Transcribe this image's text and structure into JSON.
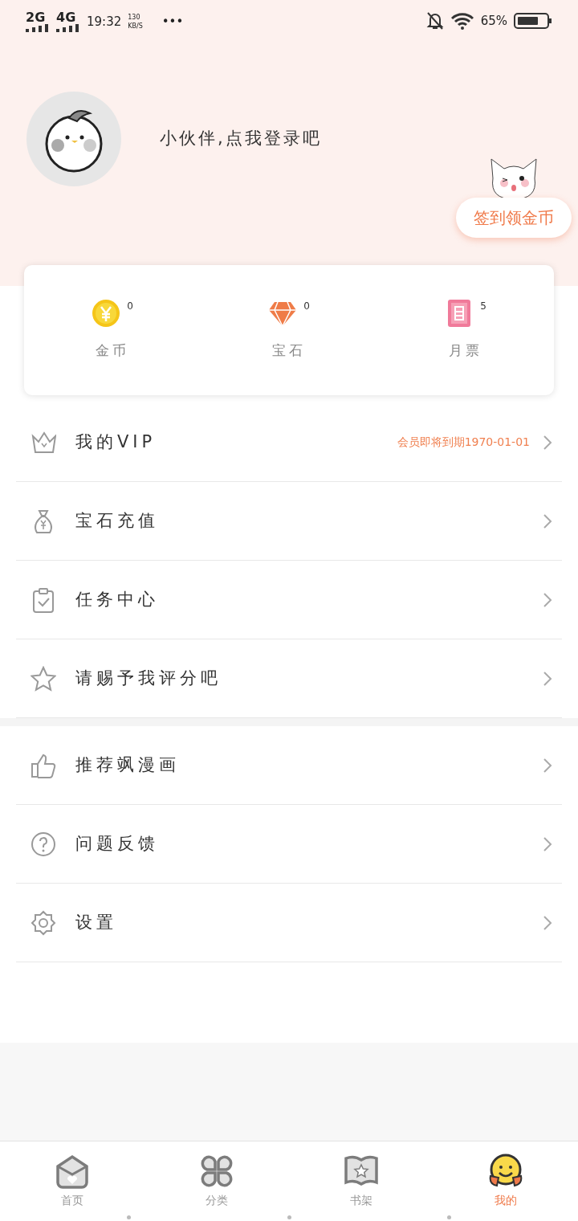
{
  "status_bar": {
    "network_1": "2G",
    "network_2": "4G",
    "time": "19:32",
    "speed_value": "130",
    "speed_unit": "KB/S",
    "more": "•••",
    "battery": "65%"
  },
  "profile": {
    "prompt": "小伙伴,点我登录吧",
    "checkin_button": "签到领金币"
  },
  "stats": [
    {
      "kind": "coin",
      "value": "0",
      "label": "金币"
    },
    {
      "kind": "gem",
      "value": "0",
      "label": "宝石"
    },
    {
      "kind": "ticket",
      "value": "5",
      "label": "月票"
    }
  ],
  "menu_groups": [
    [
      {
        "kind": "crown",
        "label": "我的VIP",
        "note": "会员即将到期1970-01-01"
      },
      {
        "kind": "moneybag",
        "label": "宝石充值"
      },
      {
        "kind": "clipboard",
        "label": "任务中心"
      },
      {
        "kind": "star",
        "label": "请赐予我评分吧"
      }
    ],
    [
      {
        "kind": "thumb",
        "label": "推荐飒漫画"
      },
      {
        "kind": "question",
        "label": "问题反馈"
      },
      {
        "kind": "gear",
        "label": "设置"
      }
    ]
  ],
  "tab_bar": [
    {
      "kind": "home",
      "label": "首页",
      "selected": false
    },
    {
      "kind": "category",
      "label": "分类",
      "selected": false
    },
    {
      "kind": "shelf",
      "label": "书架",
      "selected": false
    },
    {
      "kind": "mine",
      "label": "我的",
      "selected": true
    }
  ]
}
